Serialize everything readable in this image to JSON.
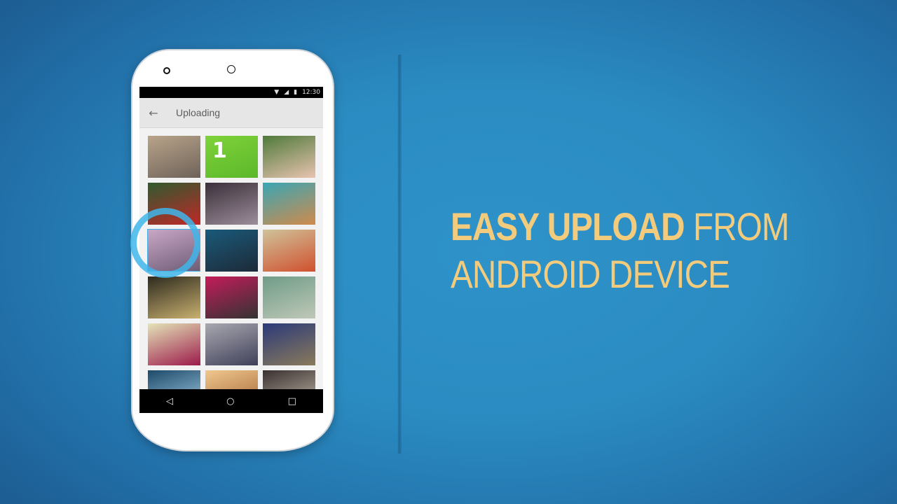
{
  "status_bar": {
    "wifi_icon": "wifi-icon",
    "signal_icon": "signal-icon",
    "battery_icon": "battery-icon",
    "time": "12:30"
  },
  "app_bar": {
    "back_icon": "←",
    "title": "Uploading"
  },
  "gallery": {
    "selected_index": 6,
    "tiles": [
      {
        "name": "road",
        "color1": "#b9a48a",
        "color2": "#6e6259"
      },
      {
        "name": "green-binary",
        "color1": "#7fd23a",
        "color2": "#5cb82a",
        "text": "1"
      },
      {
        "name": "flip-flops",
        "color1": "#4f7a3a",
        "color2": "#e8c3b0"
      },
      {
        "name": "holly-berries",
        "color1": "#2f5a2f",
        "color2": "#c02828"
      },
      {
        "name": "parking-garage",
        "color1": "#3a2f3a",
        "color2": "#9c8e9a"
      },
      {
        "name": "map",
        "color1": "#3aa6b5",
        "color2": "#d08a4b"
      },
      {
        "name": "laptop",
        "color1": "#c9a7c7",
        "color2": "#6c5b74"
      },
      {
        "name": "train-window",
        "color1": "#1a5a7a",
        "color2": "#1d2a38"
      },
      {
        "name": "red-shoes",
        "color1": "#cfc39a",
        "color2": "#d0502e"
      },
      {
        "name": "forest-floor",
        "color1": "#2d2a1d",
        "color2": "#c9b070"
      },
      {
        "name": "eiffel-poster",
        "color1": "#c41c5a",
        "color2": "#333"
      },
      {
        "name": "spiral-fan",
        "color1": "#6e9c87",
        "color2": "#c0c8b8"
      },
      {
        "name": "pink-car",
        "color1": "#e4e4b8",
        "color2": "#9c1a4a"
      },
      {
        "name": "polaroid-camera",
        "color1": "#a8a8b0",
        "color2": "#40405a"
      },
      {
        "name": "mountains",
        "color1": "#2b3a7a",
        "color2": "#8a7a5a"
      },
      {
        "name": "sunburst",
        "color1": "#1d4a6a",
        "color2": "#a8d0e8"
      },
      {
        "name": "warm-blur",
        "color1": "#f0c890",
        "color2": "#a06030"
      },
      {
        "name": "slot-machine",
        "color1": "#3a3030",
        "color2": "#c8c0b0"
      }
    ]
  },
  "nav_bar": {
    "back": "◁",
    "home": "○",
    "recents": "□"
  },
  "headline": {
    "bold": "EASY UPLOAD",
    "line1_rest": " FROM",
    "line2": "ANDROID DEVICE"
  }
}
